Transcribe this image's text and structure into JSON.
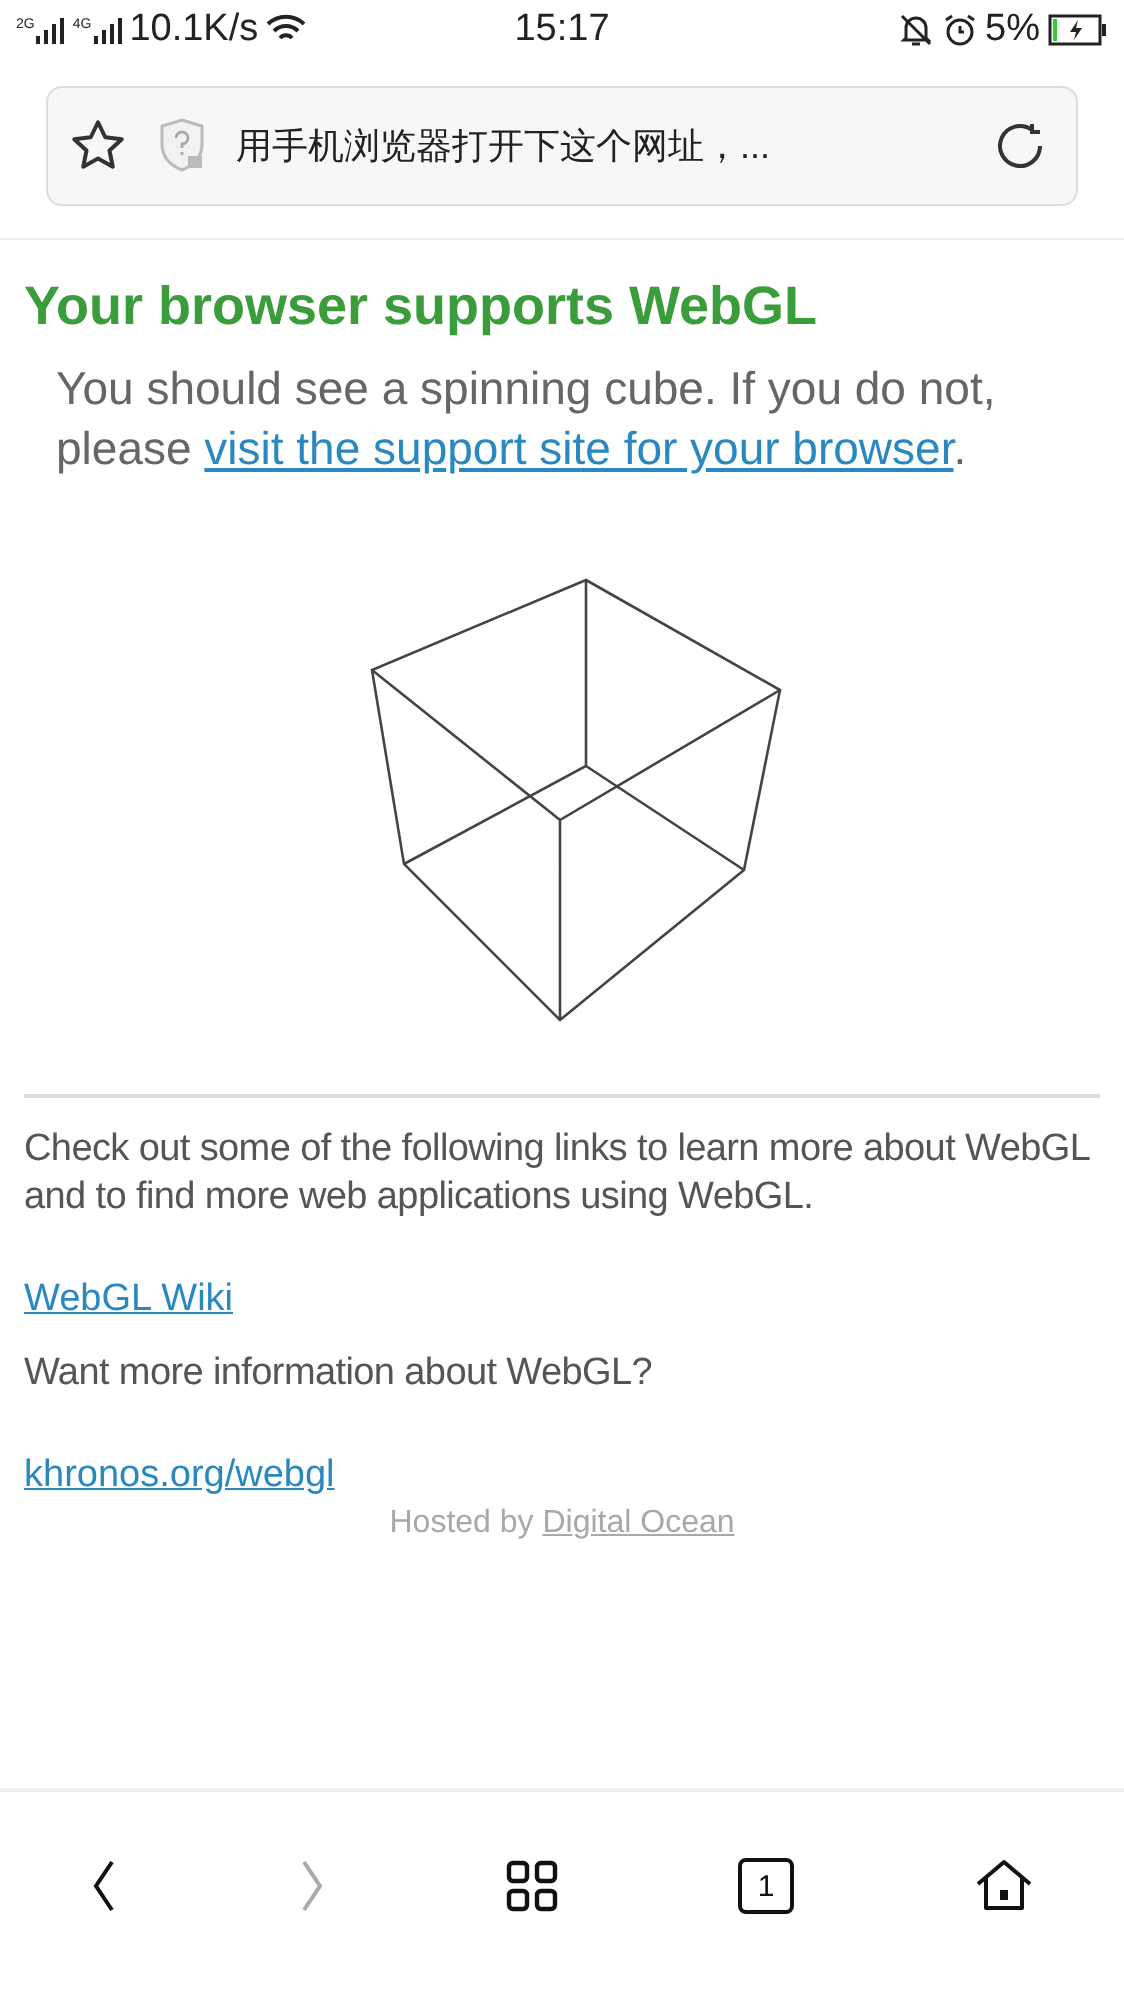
{
  "status_bar": {
    "networks": [
      "2G",
      "4G"
    ],
    "speed": "10.1K/s",
    "time": "15:17",
    "battery": "5%"
  },
  "address_bar": {
    "title": "用手机浏览器打开下这个网址，..."
  },
  "page": {
    "heading": "Your browser supports WebGL",
    "intro": {
      "text": "You should see a spinning cube. If you do not, please ",
      "link": "visit the support site for your browser",
      "end": "."
    },
    "info": "Check out some of the following links to learn more about WebGL and to find more web applications using WebGL.",
    "items": [
      {
        "kind": "link",
        "text": "WebGL Wiki"
      },
      {
        "kind": "text",
        "text": "Want more information about WebGL?"
      },
      {
        "kind": "link",
        "text": "khronos.org/webgl"
      }
    ],
    "footer": {
      "text": "Hosted by ",
      "link": "Digital Ocean"
    }
  },
  "nav": [
    {
      "kind": "back",
      "disabled": false
    },
    {
      "kind": "forward",
      "disabled": true
    },
    {
      "kind": "menu",
      "disabled": false
    },
    {
      "kind": "tabs",
      "disabled": false,
      "count": "1"
    },
    {
      "kind": "home",
      "disabled": false
    }
  ]
}
